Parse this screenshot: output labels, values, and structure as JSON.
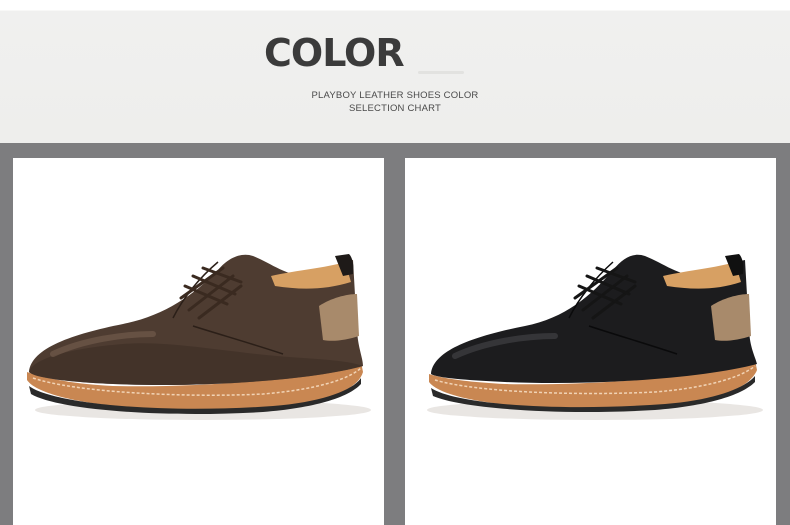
{
  "header": {
    "title": "COLOR",
    "subtitle_line1": "PLAYBOY LEATHER SHOES COLOR",
    "subtitle_line2": "SELECTION CHART"
  },
  "products": [
    {
      "color_name": "brown",
      "upper": "#4e3c31",
      "upper_shade": "#2b1f18",
      "upper_highlight": "#7a6252",
      "lace": "#3a2a20"
    },
    {
      "color_name": "black",
      "upper": "#1c1c1e",
      "upper_shade": "#0a0a0b",
      "upper_highlight": "#4a4a4e",
      "lace": "#151515"
    }
  ],
  "colors": {
    "background": "#7d7d7f",
    "panel": "#ffffff",
    "header": "#eeeeec",
    "title": "#3b3b3b",
    "sole_tan": "#c98752",
    "sole_dark": "#2a2a2a",
    "heel_tab": "#a88a6b"
  }
}
